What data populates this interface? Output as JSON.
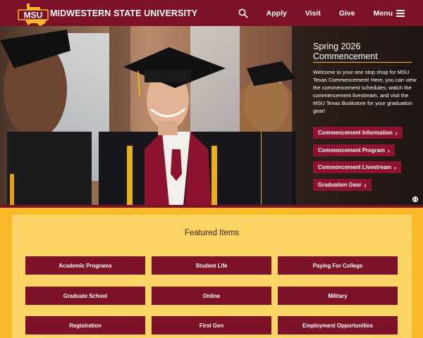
{
  "header": {
    "logo_text": "MSU",
    "brand": "MIDWESTERN STATE UNIVERSITY",
    "nav": [
      {
        "label": "Apply"
      },
      {
        "label": "Visit"
      },
      {
        "label": "Give"
      }
    ],
    "menu_label": "Menu",
    "search_icon": "search-icon",
    "menu_icon": "hamburger-icon"
  },
  "hero": {
    "title": "Spring 2026 Commencement",
    "text": "Welcome to your one stop shop for MSU Texas Commencement! Here, you can view the commencement schedules, watch the commencement livestream, and visit the MSU Texas Bookstore for your graduation gear!",
    "buttons": [
      {
        "label": "Commencement Information"
      },
      {
        "label": "Commencement Program"
      },
      {
        "label": "Commencement Livestream"
      },
      {
        "label": "Graduation Gear"
      }
    ],
    "pause_icon": "pause-icon"
  },
  "featured": {
    "title": "Featured Items",
    "items": [
      {
        "label": "Academic Programs"
      },
      {
        "label": "Student Life"
      },
      {
        "label": "Paying For College"
      },
      {
        "label": "Graduate School"
      },
      {
        "label": "Online"
      },
      {
        "label": "Military"
      },
      {
        "label": "Registration"
      },
      {
        "label": "First Gen"
      },
      {
        "label": "Employment Opportunities"
      }
    ]
  },
  "colors": {
    "maroon": "#7d1128",
    "gold": "#fbb829",
    "button_maroon": "#8c1230"
  }
}
